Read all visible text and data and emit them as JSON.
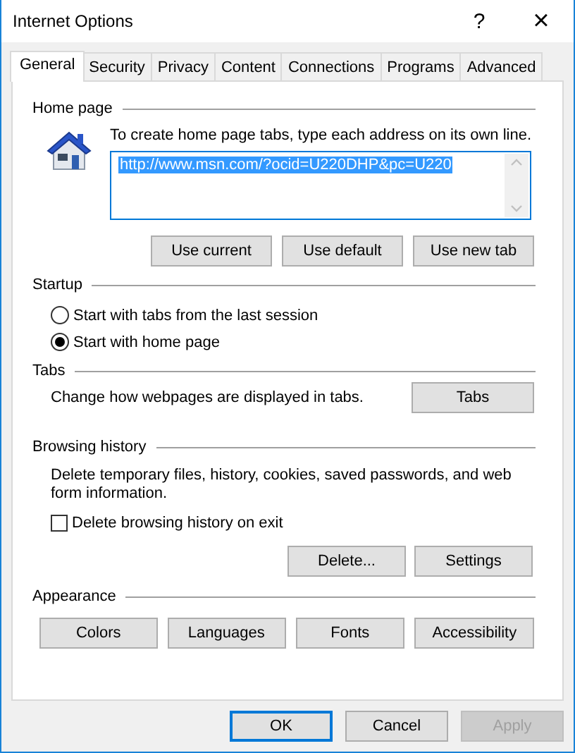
{
  "window": {
    "title": "Internet Options",
    "help_button": "?",
    "close_button": "×"
  },
  "tabs": [
    {
      "label": "General",
      "selected": true
    },
    {
      "label": "Security",
      "selected": false
    },
    {
      "label": "Privacy",
      "selected": false
    },
    {
      "label": "Content",
      "selected": false
    },
    {
      "label": "Connections",
      "selected": false
    },
    {
      "label": "Programs",
      "selected": false
    },
    {
      "label": "Advanced",
      "selected": false
    }
  ],
  "home_page": {
    "heading": "Home page",
    "instruction": "To create home page tabs, type each address on its own line.",
    "address": {
      "value": "http://www.msn.com/?ocid=U220DHP&pc=U220",
      "selected": true
    },
    "buttons": [
      "Use current",
      "Use default",
      "Use new tab"
    ]
  },
  "startup": {
    "heading": "Startup",
    "options": [
      {
        "label": "Start with tabs from the last session",
        "selected": false
      },
      {
        "label": "Start with home page",
        "selected": true
      }
    ]
  },
  "tabs_section": {
    "heading": "Tabs",
    "description": "Change how webpages are displayed in tabs.",
    "button": "Tabs"
  },
  "browsing_history": {
    "heading": "Browsing history",
    "description": "Delete temporary files, history, cookies, saved passwords, and web form information.",
    "delete_on_exit": {
      "label": "Delete browsing history on exit",
      "checked": false
    },
    "buttons": [
      "Delete...",
      "Settings"
    ]
  },
  "appearance": {
    "heading": "Appearance",
    "buttons": [
      "Colors",
      "Languages",
      "Fonts",
      "Accessibility"
    ]
  },
  "dialog_buttons": [
    {
      "label": "OK",
      "default": true,
      "disabled": false
    },
    {
      "label": "Cancel",
      "default": false,
      "disabled": false
    },
    {
      "label": "Apply",
      "default": false,
      "disabled": true
    }
  ]
}
